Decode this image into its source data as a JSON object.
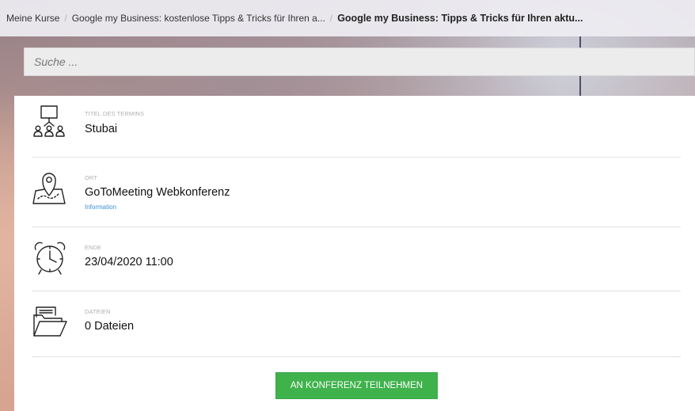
{
  "breadcrumb": {
    "items": [
      "Meine Kurse",
      "Google my Business: kostenlose Tipps & Tricks für Ihren a...",
      "Google my Business: Tipps & Tricks für Ihren aktu..."
    ]
  },
  "search": {
    "placeholder": "Suche ..."
  },
  "event": {
    "title": {
      "label": "TITEL DES TERMINS",
      "value": "Stubai",
      "icon": "presentation-audience-icon"
    },
    "location": {
      "label": "ORT",
      "value": "GoToMeeting Webkonferenz",
      "link": "Information",
      "icon": "map-pin-icon"
    },
    "end": {
      "label": "ENDE",
      "value": "23/04/2020 11:00",
      "icon": "alarm-clock-icon"
    },
    "files": {
      "label": "DATEIEN",
      "value": "0 Dateien",
      "icon": "folder-icon"
    }
  },
  "join_button": {
    "label": "AN KONFERENZ TEILNEHMEN",
    "color": "#3fb24c"
  },
  "colors": {
    "link": "#3a8fd8"
  }
}
